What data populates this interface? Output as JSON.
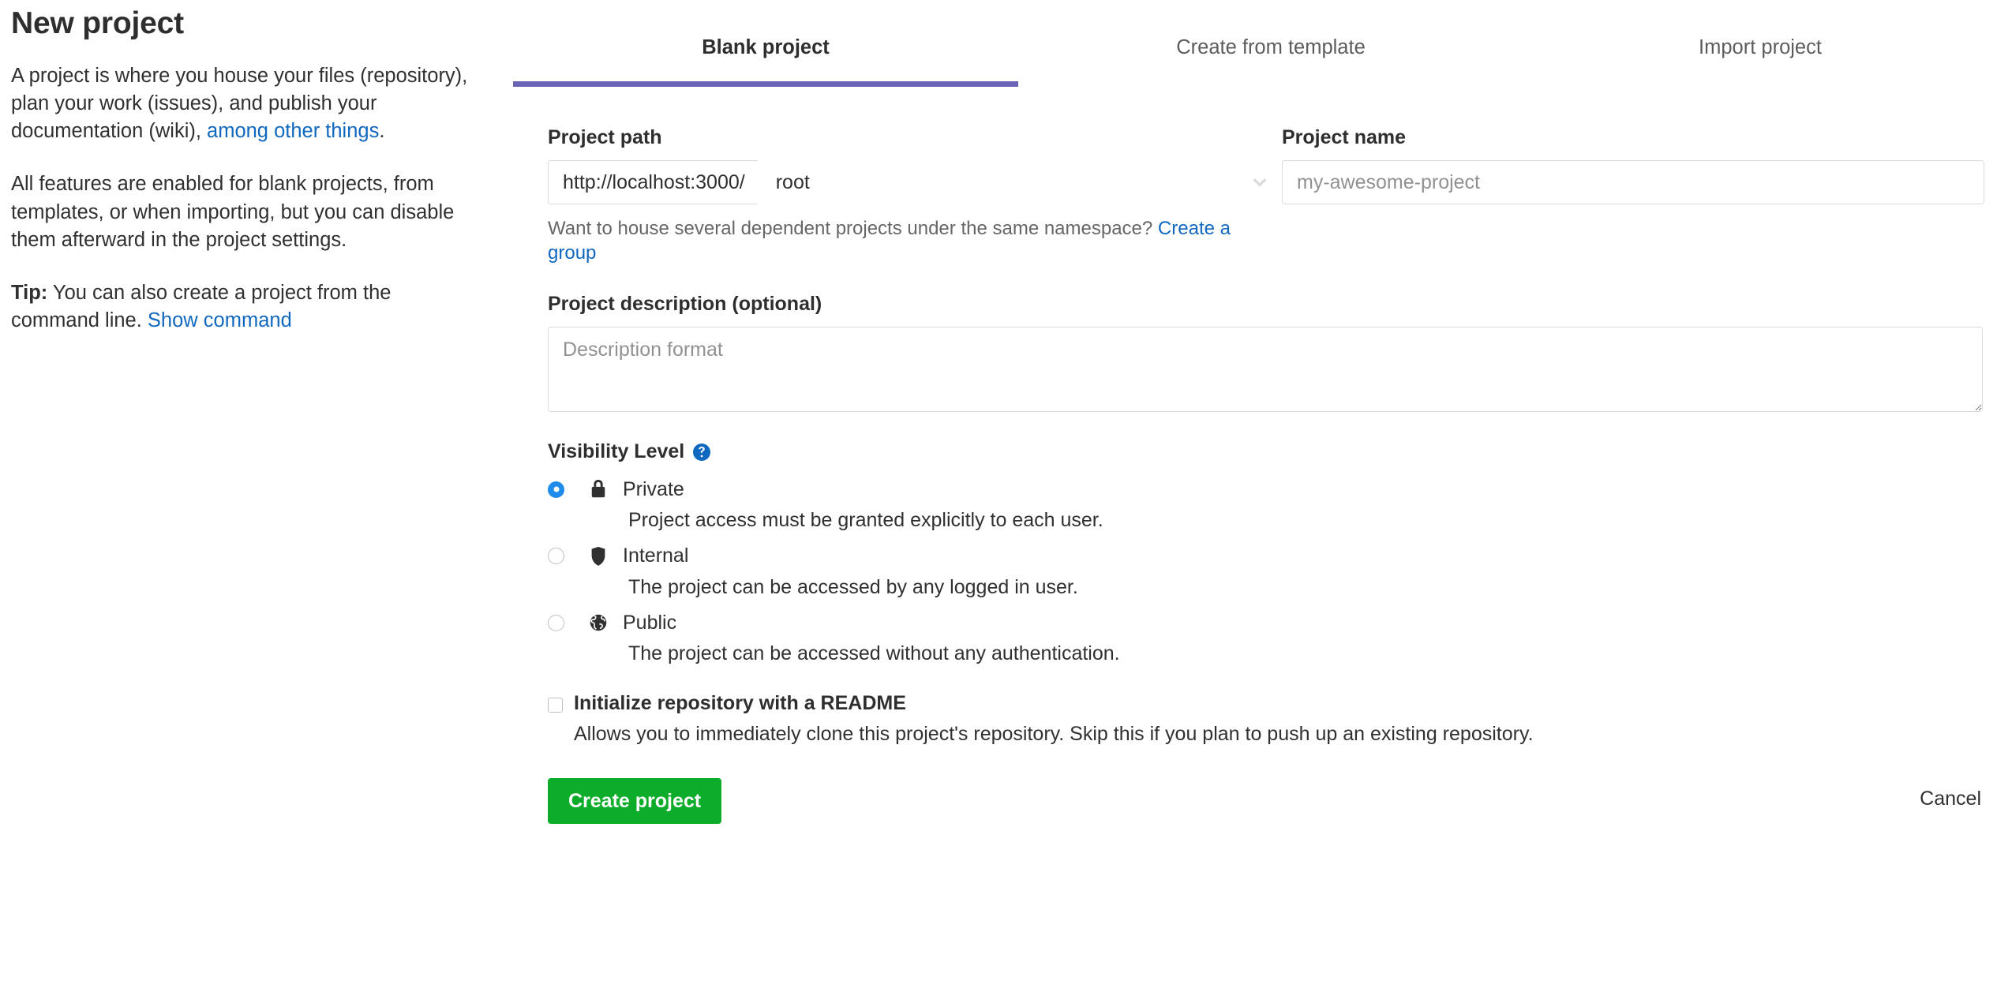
{
  "sidebar": {
    "title": "New project",
    "paragraph1_prefix": "A project is where you house your files (repository), plan your work (issues), and publish your documentation (wiki), ",
    "paragraph1_link": "among other things",
    "paragraph1_suffix": ".",
    "paragraph2": "All features are enabled for blank projects, from templates, or when importing, but you can disable them afterward in the project settings.",
    "tip_label": "Tip:",
    "tip_text": " You can also create a project from the command line. ",
    "tip_link": "Show command"
  },
  "tabs": [
    {
      "label": "Blank project",
      "active": true
    },
    {
      "label": "Create from template",
      "active": false
    },
    {
      "label": "Import project",
      "active": false
    }
  ],
  "form": {
    "project_path": {
      "label": "Project path",
      "url_prefix": "http://localhost:3000/",
      "namespace_value": "root",
      "chevron_icon": "chevron-down-icon",
      "help_text": "Want to house several dependent projects under the same namespace? ",
      "help_link": "Create a group"
    },
    "project_name": {
      "label": "Project name",
      "value": "",
      "placeholder": "my-awesome-project"
    },
    "project_description": {
      "label": "Project description (optional)",
      "value": "",
      "placeholder": "Description format"
    },
    "visibility": {
      "title": "Visibility Level",
      "help_icon": "question-circle-icon",
      "options": [
        {
          "id": "private",
          "name": "Private",
          "icon": "lock-icon",
          "description": "Project access must be granted explicitly to each user.",
          "selected": true
        },
        {
          "id": "internal",
          "name": "Internal",
          "icon": "shield-icon",
          "description": "The project can be accessed by any logged in user.",
          "selected": false
        },
        {
          "id": "public",
          "name": "Public",
          "icon": "globe-icon",
          "description": "The project can be accessed without any authentication.",
          "selected": false
        }
      ]
    },
    "readme": {
      "label": "Initialize repository with a README",
      "description": "Allows you to immediately clone this project's repository. Skip this if you plan to push up an existing repository.",
      "checked": false
    },
    "actions": {
      "submit_label": "Create project",
      "cancel_label": "Cancel"
    }
  },
  "colors": {
    "link": "#1068bf",
    "active_tab_underline": "#6b63b5",
    "primary_button": "#0eac2b",
    "radio_selected": "#1f8ceb",
    "help_icon": "#1068bf"
  }
}
